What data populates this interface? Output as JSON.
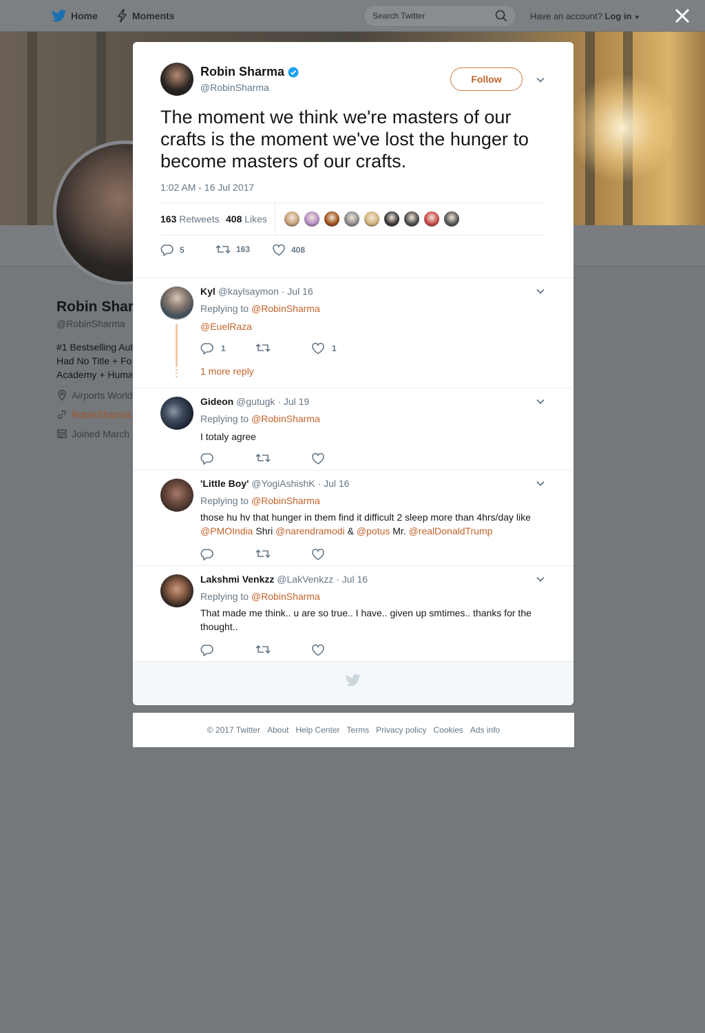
{
  "topnav": {
    "home_label": "Home",
    "moments_label": "Moments",
    "search_placeholder": "Search Twitter",
    "have_account": "Have an account?",
    "login_label": "Log in"
  },
  "background_profile": {
    "name": "Robin Shar",
    "handle": "@RobinSharma",
    "bio_lines": [
      "#1 Bestselling Aut",
      "Had No Title + Fo",
      "Academy + Huma"
    ],
    "location": "Airports World",
    "website": "RobinSharma.",
    "joined": "Joined March"
  },
  "tweet": {
    "author_name": "Robin Sharma",
    "author_handle": "@RobinSharma",
    "follow_label": "Follow",
    "text": "The moment we think we're masters of our crafts is the moment we've lost the hunger to become masters of our crafts.",
    "timestamp": "1:02 AM - 16 Jul 2017",
    "retweets_count": "163",
    "retweets_label": "Retweets",
    "likes_count": "408",
    "likes_label": "Likes",
    "reply_count": "5",
    "retweet_action_count": "163",
    "like_action_count": "408",
    "liker_colors": [
      "#c9a27a",
      "#b58fc4",
      "#a0521e",
      "#8e8e8e",
      "#d4b57c",
      "#3a3a3a",
      "#4d4d4d",
      "#c94b4b",
      "#555555"
    ]
  },
  "replies": [
    {
      "name": "Kyl",
      "handle": "@kaylsaymon",
      "date": "Jul 16",
      "replying_prefix": "Replying to",
      "replying_to": "@RobinSharma",
      "text_mention": "@EuelRaza",
      "reply_count": "1",
      "like_count": "1",
      "more_reply": "1 more reply"
    },
    {
      "name": "Gideon",
      "handle": "@gutugk",
      "date": "Jul 19",
      "replying_prefix": "Replying to",
      "replying_to": "@RobinSharma",
      "text": "I totaly agree"
    },
    {
      "name": "'Little Boy'",
      "handle": "@YogiAshishK",
      "date": "Jul 16",
      "replying_prefix": "Replying to",
      "replying_to": "@RobinSharma",
      "text_part1": "those hu hv that hunger in them find it difficult 2 sleep more than 4hrs/day like",
      "mention1": "@PMOIndia",
      "text_part2": " Shri ",
      "mention2": "@narendramodi",
      "text_part3": " & ",
      "mention3": "@potus",
      "text_part4": " Mr. ",
      "mention4": "@realDonaldTrump"
    },
    {
      "name": "Lakshmi Venkzz",
      "handle": "@LakVenkzz",
      "date": "Jul 16",
      "replying_prefix": "Replying to",
      "replying_to": "@RobinSharma",
      "text": "That made me think.. u are so true.. I have.. given up smtimes.. thanks for the thought.."
    }
  ],
  "footer": {
    "copyright": "© 2017 Twitter",
    "links": [
      "About",
      "Help Center",
      "Terms",
      "Privacy policy",
      "Cookies",
      "Ads info"
    ]
  },
  "colors": {
    "accent": "#c2622a",
    "verified": "#1da1f2",
    "twitter_blue": "#1b95e0"
  }
}
